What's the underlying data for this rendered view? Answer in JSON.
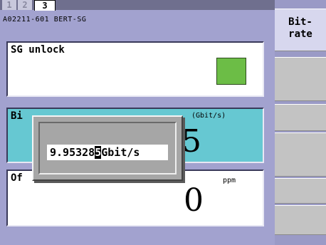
{
  "tabs": [
    {
      "label": "1"
    },
    {
      "label": "2"
    },
    {
      "label": "3"
    }
  ],
  "header": {
    "model": "A02211-601 BERT-SG"
  },
  "sg_panel": {
    "title": "SG unlock",
    "indicator_color": "#6cbd46"
  },
  "bitrate_panel": {
    "title": "Bi",
    "unit": "(Gbit/s)",
    "value_visible": "5"
  },
  "offset_panel": {
    "title": "Of",
    "unit": "ppm",
    "value": "0"
  },
  "popup": {
    "entry_before": "9.95328",
    "entry_cursor": "5",
    "entry_after": "Gbit/s"
  },
  "softkeys": [
    {
      "label_line1": "Bit-",
      "label_line2": "rate"
    },
    {
      "label": ""
    },
    {
      "label": ""
    },
    {
      "label": ""
    },
    {
      "label": ""
    },
    {
      "label": ""
    }
  ],
  "colors": {
    "background": "#a2a2cf",
    "bitrate_panel": "#66c8d2",
    "active_tab": "#ffffff"
  }
}
